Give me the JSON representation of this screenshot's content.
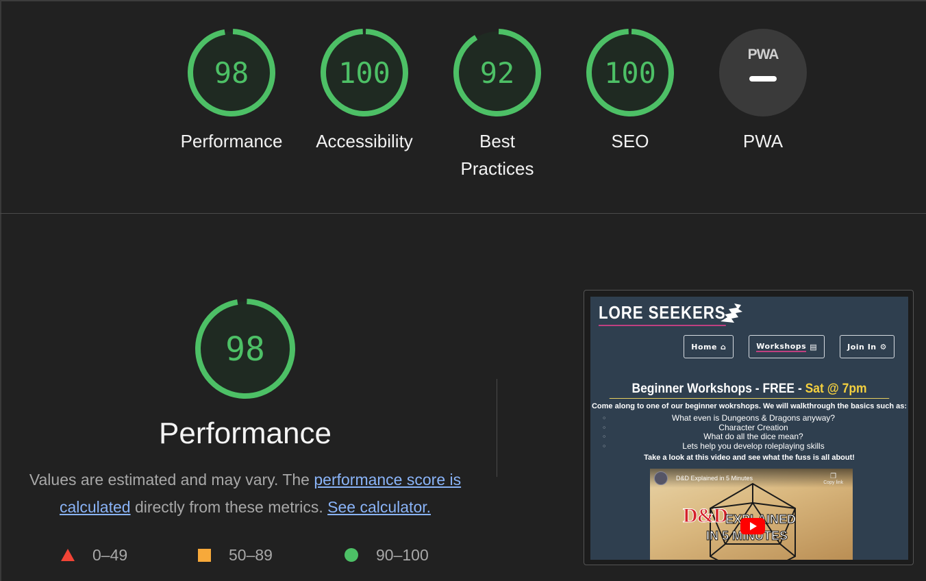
{
  "categories": [
    {
      "id": "performance",
      "score": "98",
      "value": 98,
      "label": "Performance"
    },
    {
      "id": "accessibility",
      "score": "100",
      "value": 100,
      "label": "Accessibility"
    },
    {
      "id": "best-practices",
      "score": "92",
      "value": 92,
      "label": "Best Practices"
    },
    {
      "id": "seo",
      "score": "100",
      "value": 100,
      "label": "SEO"
    },
    {
      "id": "pwa",
      "badge": "PWA",
      "label": "PWA"
    }
  ],
  "performance": {
    "score": "98",
    "value": 98,
    "title": "Performance",
    "desc_prefix": "Values are estimated and may vary. The ",
    "link_score": "performance score is calculated",
    "desc_middle": " directly from these metrics. ",
    "link_calculator": "See calculator."
  },
  "legend": {
    "fail": "0–49",
    "average": "50–89",
    "pass": "90–100"
  },
  "colors": {
    "pass": "#4dc066",
    "average": "#f7a93a",
    "fail": "#f24436",
    "pwa_bg": "#3a3a3a",
    "link": "#8ab4f8"
  },
  "thumbnail": {
    "logo": "LORE SEEKERS",
    "nav": [
      {
        "label": "Home",
        "icon": "home-icon"
      },
      {
        "label": "Workshops",
        "icon": "book-icon"
      },
      {
        "label": "Join In",
        "icon": "d20-icon"
      }
    ],
    "heading": "Beginner Workshops - FREE - ",
    "heading_highlight": "Sat @ 7pm",
    "intro": "Come along to one of our beginner wokrshops. We will walkthrough the basics such as:",
    "list": [
      "What even is Dungeons & Dragons anyway?",
      "Character Creation",
      "What do all the dice mean?",
      "Lets help you develop roleplaying skills"
    ],
    "outro": "Take a look at this video and see what the fuss is all about!",
    "video": {
      "title": "D&D Explained in 5 Minutes",
      "copy_link": "Copy link",
      "art_dd": "D&D",
      "art_explained": "EXPLAINED",
      "art_minutes": "IN 5 MINUTES"
    }
  }
}
